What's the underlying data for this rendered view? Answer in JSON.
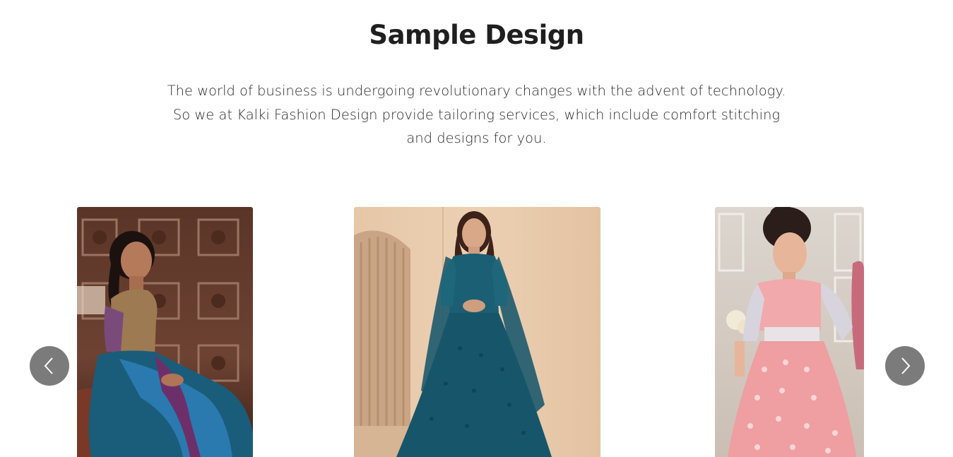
{
  "section": {
    "title": "Sample Design",
    "description_lines": [
      "The world of business is undergoing revolutionary changes with the advent of technology.",
      "So we at Kalki Fashion Design provide tailoring services, which include comfort stitching",
      "and designs for you."
    ]
  },
  "carousel": {
    "items": [
      {
        "name": "woman-in-silk-saree-photo",
        "icon": "photo"
      },
      {
        "name": "woman-in-teal-anarkali-photo",
        "icon": "photo"
      },
      {
        "name": "girl-in-pink-lehenga-photo",
        "icon": "photo"
      }
    ],
    "prev_icon": "chevron-left-icon",
    "next_icon": "chevron-right-icon",
    "button_color": "#7b7b7b"
  }
}
